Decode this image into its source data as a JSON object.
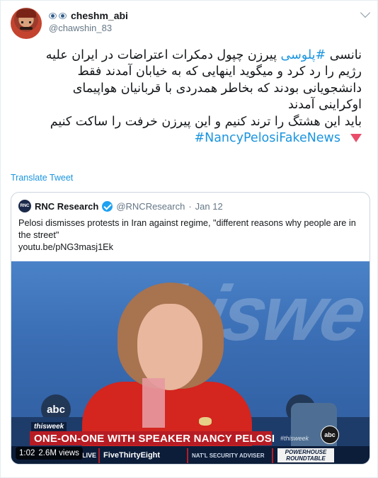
{
  "tweet": {
    "display_name": "cheshm_abi",
    "handle": "@chawshin_83",
    "icons": [
      "eye-icon",
      "eye-icon",
      "caret-down-icon",
      "triangle-down-icon"
    ],
    "body": {
      "line1_prefix": "نانسی ",
      "line1_hashtag": "#پلوسی",
      "line1_suffix": " پیرزن چپول دمکرات اعتراضات در ایران علیه",
      "line2": "رژیم را رد کرد و میگوید اینهایی که به خیابان آمدند فقط",
      "line3": "دانشجویانی بودند که بخاطر همدردی با قربانیان هواپیمای",
      "line4": "اوکراینی آمدند",
      "line5": "باید این هشتگ را ترند کنیم و این پیرزن خرفت را ساکت کنیم",
      "line6_hashtag": "#NancyPelosiFakeNews"
    },
    "translate_label": "Translate Tweet",
    "accent_color": "#1b95e0"
  },
  "quoted": {
    "logo_text": "RNC",
    "name": "RNC Research",
    "handle": "@RNCResearch",
    "separator": "·",
    "date": "Jan 12",
    "text": "Pelosi dismisses protests in Iran against regime, \"different reasons why people are in the street\"",
    "link": "youtu.be/pNG3masj1Ek"
  },
  "video": {
    "background_text": "hiswe",
    "show_logo": "thisweek",
    "headline": "ONE-ON-ONE WITH SPEAKER NANCY PELOSI",
    "hashtag_bug": "#thisweek",
    "network_bug": "abc",
    "ticker": {
      "item1": "LIVE",
      "item2": "FiveThirtyEight",
      "item3": "NAT'L SECURITY ADVISER",
      "item4_line1": "POWERHOUSE",
      "item4_line2": "ROUNDTABLE"
    },
    "time": "1:02",
    "views": "2.6M views"
  }
}
